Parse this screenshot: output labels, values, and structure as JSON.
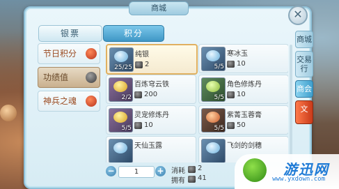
{
  "window": {
    "title": "商城",
    "close_symbol": "✕"
  },
  "top_tabs": [
    {
      "label": "银票",
      "active": false
    },
    {
      "label": "积分",
      "active": true
    }
  ],
  "left_categories": [
    {
      "label": "节日积分",
      "selected": false
    },
    {
      "label": "功绩值",
      "selected": true
    },
    {
      "label": "神兵之魂",
      "selected": false
    }
  ],
  "items": [
    {
      "name": "纯银",
      "qty": "25/25",
      "price": "2",
      "color": "blue",
      "selected": true
    },
    {
      "name": "寒冰玉",
      "qty": "5/5",
      "price": "10",
      "color": "blue",
      "selected": false
    },
    {
      "name": "百炼穹云铁",
      "qty": "2/2",
      "price": "200",
      "color": "yellow",
      "selected": false
    },
    {
      "name": "角色修炼丹",
      "qty": "5/5",
      "price": "10",
      "color": "green",
      "selected": false
    },
    {
      "name": "灵宠修炼丹",
      "qty": "5/5",
      "price": "10",
      "color": "yellow",
      "selected": false
    },
    {
      "name": "紫菁玉蓉膏",
      "qty": "5/5",
      "price": "50",
      "color": "red",
      "selected": false
    },
    {
      "name": "天仙玉露",
      "qty": "",
      "price": "",
      "color": "blue",
      "selected": false
    },
    {
      "name": "飞剑的剑穗",
      "qty": "",
      "price": "",
      "color": "blue",
      "selected": false
    }
  ],
  "footer": {
    "quantity": "1",
    "minus": "−",
    "plus": "+",
    "cost_label": "消耗",
    "cost_value": "2",
    "own_label": "拥有",
    "own_value": "41"
  },
  "side_tabs": [
    {
      "label": "商城",
      "active": false
    },
    {
      "label": "交易行",
      "active": false
    },
    {
      "label": "商会",
      "active": true
    },
    {
      "label": "文",
      "active": false
    }
  ],
  "watermark": {
    "text": "游迅网",
    "url": "www.yxdown.com"
  }
}
